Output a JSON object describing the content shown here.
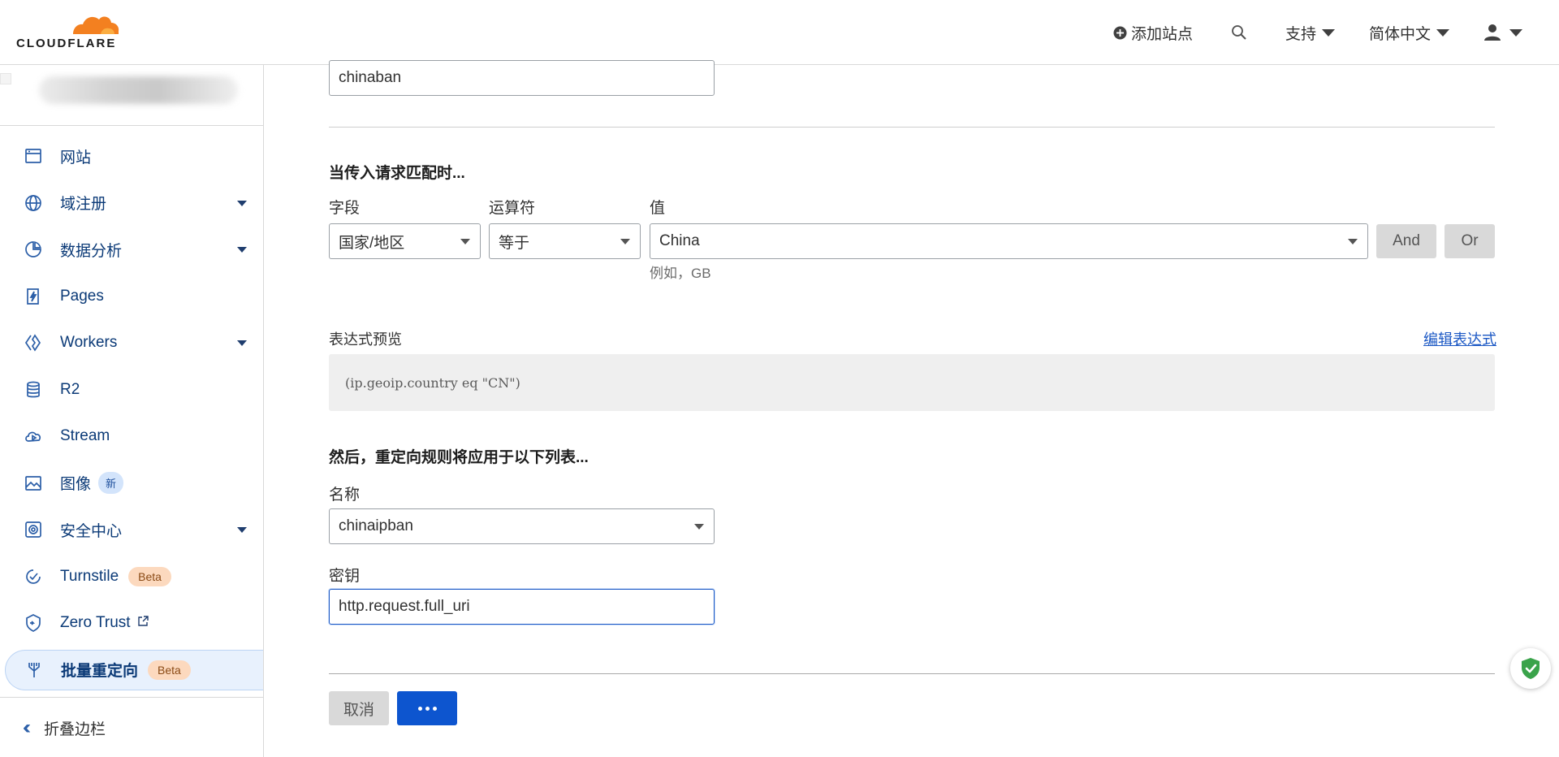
{
  "colors": {
    "accent": "#0d55cf",
    "brand_orange": "#f38020",
    "progress": "#e0241a",
    "active_bg": "#e8f1fd"
  },
  "progress": {
    "fraction": 0.285
  },
  "header": {
    "logo_text": "CLOUDFLARE",
    "add_site": "添加站点",
    "support": "支持",
    "language": "简体中文",
    "icons": [
      "plus-circle-icon",
      "search-icon",
      "user-icon"
    ]
  },
  "sidebar": {
    "items": [
      {
        "label": "网站",
        "icon": "browser-window-icon",
        "has_chevron": false
      },
      {
        "label": "域注册",
        "icon": "globe-icon",
        "has_chevron": true
      },
      {
        "label": "数据分析",
        "icon": "pie-chart-icon",
        "has_chevron": true
      },
      {
        "label": "Pages",
        "icon": "lightning-page-icon",
        "has_chevron": false
      },
      {
        "label": "Workers",
        "icon": "workers-icon",
        "has_chevron": true
      },
      {
        "label": "R2",
        "icon": "database-icon",
        "has_chevron": false
      },
      {
        "label": "Stream",
        "icon": "cloud-play-icon",
        "has_chevron": false
      },
      {
        "label": "图像",
        "icon": "image-icon",
        "badge": "新",
        "has_chevron": false
      },
      {
        "label": "安全中心",
        "icon": "security-gear-icon",
        "has_chevron": true
      },
      {
        "label": "Turnstile",
        "icon": "turnstile-icon",
        "badge": "Beta",
        "has_chevron": false
      },
      {
        "label": "Zero Trust",
        "icon": "zero-trust-icon",
        "external": true,
        "has_chevron": false
      },
      {
        "label": "批量重定向",
        "icon": "bulk-redirect-icon",
        "badge": "Beta",
        "active": true,
        "has_chevron": false
      }
    ],
    "collapse_label": "折叠边栏"
  },
  "form": {
    "top_input_value": "chinaban",
    "match_title": "当传入请求匹配时...",
    "field_label": "字段",
    "field_value": "国家/地区",
    "operator_label": "运算符",
    "operator_value": "等于",
    "value_label": "值",
    "value_value": "China",
    "value_hint": "例如，GB",
    "and_label": "And",
    "or_label": "Or",
    "expr_preview_label": "表达式预览",
    "edit_expr_link": "编辑表达式",
    "expr_text": "(ip.geoip.country eq \"CN\")",
    "then_title": "然后，重定向规则将应用于以下列表...",
    "name_label": "名称",
    "name_value": "chinaipban",
    "key_label": "密钥",
    "key_value": "http.request.full_uri",
    "cancel_label": "取消",
    "submit_state": "loading"
  }
}
